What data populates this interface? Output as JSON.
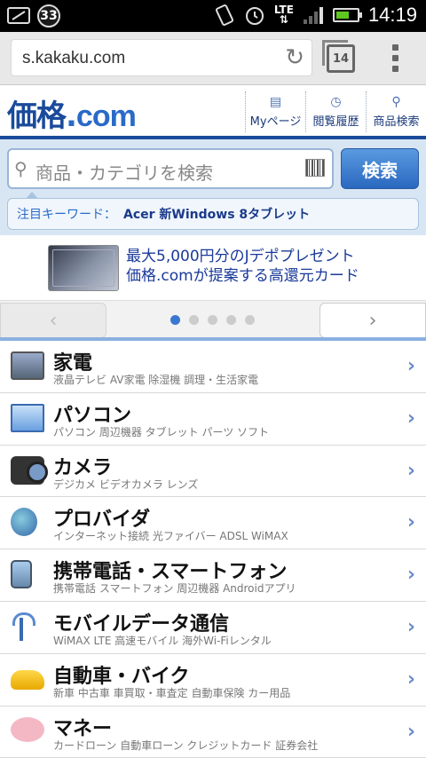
{
  "status_bar": {
    "notification_count": "33",
    "network": "LTE",
    "time": "14:19",
    "battery_level": 0.65
  },
  "browser": {
    "url": "s.kakaku.com",
    "tab_count": "14"
  },
  "header": {
    "logo_main": "価格",
    "logo_dot": ".",
    "logo_com": "com",
    "nav": [
      {
        "label": "Myページ",
        "icon": "profile-icon"
      },
      {
        "label": "閲覧履歴",
        "icon": "clock-icon"
      },
      {
        "label": "商品検索",
        "icon": "search-icon"
      }
    ]
  },
  "search": {
    "placeholder": "商品・カテゴリを検索",
    "button_label": "検索",
    "keyword_label": "注目キーワード：",
    "keyword_value": "Acer 新Windows 8タブレット"
  },
  "banner": {
    "line1": "最大5,000円分のJデポプレゼント",
    "line2": "価格.comが提案する高還元カード"
  },
  "carousel": {
    "left_arrow": "‹",
    "right_arrow": "›",
    "page_count": 5,
    "active_index": 0
  },
  "categories": [
    {
      "title": "家電",
      "sub": "液晶テレビ AV家電 除湿機 調理・生活家電",
      "icon": "tv-icon"
    },
    {
      "title": "パソコン",
      "sub": "パソコン 周辺機器 タブレット パーツ ソフト",
      "icon": "laptop-icon"
    },
    {
      "title": "カメラ",
      "sub": "デジカメ ビデオカメラ レンズ",
      "icon": "camera-icon"
    },
    {
      "title": "プロバイダ",
      "sub": "インターネット接続 光ファイバー ADSL WiMAX",
      "icon": "globe-icon"
    },
    {
      "title": "携帯電話・スマートフォン",
      "sub": "携帯電話 スマートフォン 周辺機器 Androidアプリ",
      "icon": "phone-icon"
    },
    {
      "title": "モバイルデータ通信",
      "sub": "WiMAX LTE 高速モバイル 海外Wi-Fiレンタル",
      "icon": "antenna-icon"
    },
    {
      "title": "自動車・バイク",
      "sub": "新車 中古車 車買取・車査定 自動車保険 カー用品",
      "icon": "car-icon"
    },
    {
      "title": "マネー",
      "sub": "カードローン 自動車ローン クレジットカード 証券会社",
      "icon": "piggy-bank-icon"
    }
  ],
  "arrow_glyph": "›",
  "colors": {
    "brand": "#1a4a9a",
    "accent": "#2a6ac8",
    "search_bg": "#d8e6f4"
  }
}
